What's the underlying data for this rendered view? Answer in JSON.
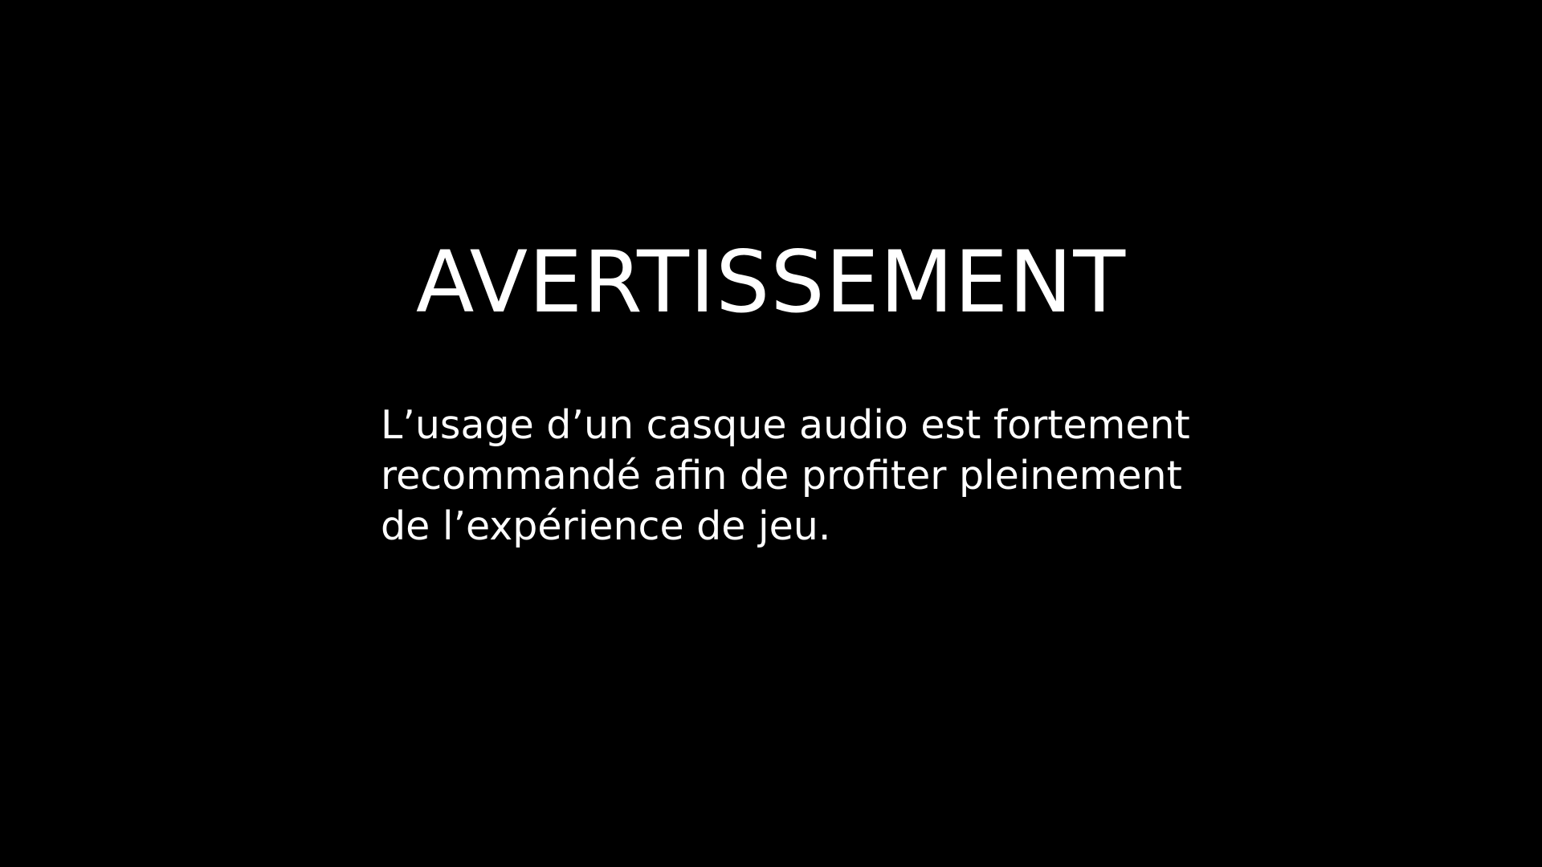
{
  "warning": {
    "title": "AVERTISSEMENT",
    "lines": [
      "L’usage d’un casque audio est fortement",
      "recommandé afin de profiter pleinement",
      "de l’expérience de jeu."
    ]
  },
  "colors": {
    "background": "#000000",
    "text": "#ffffff"
  }
}
